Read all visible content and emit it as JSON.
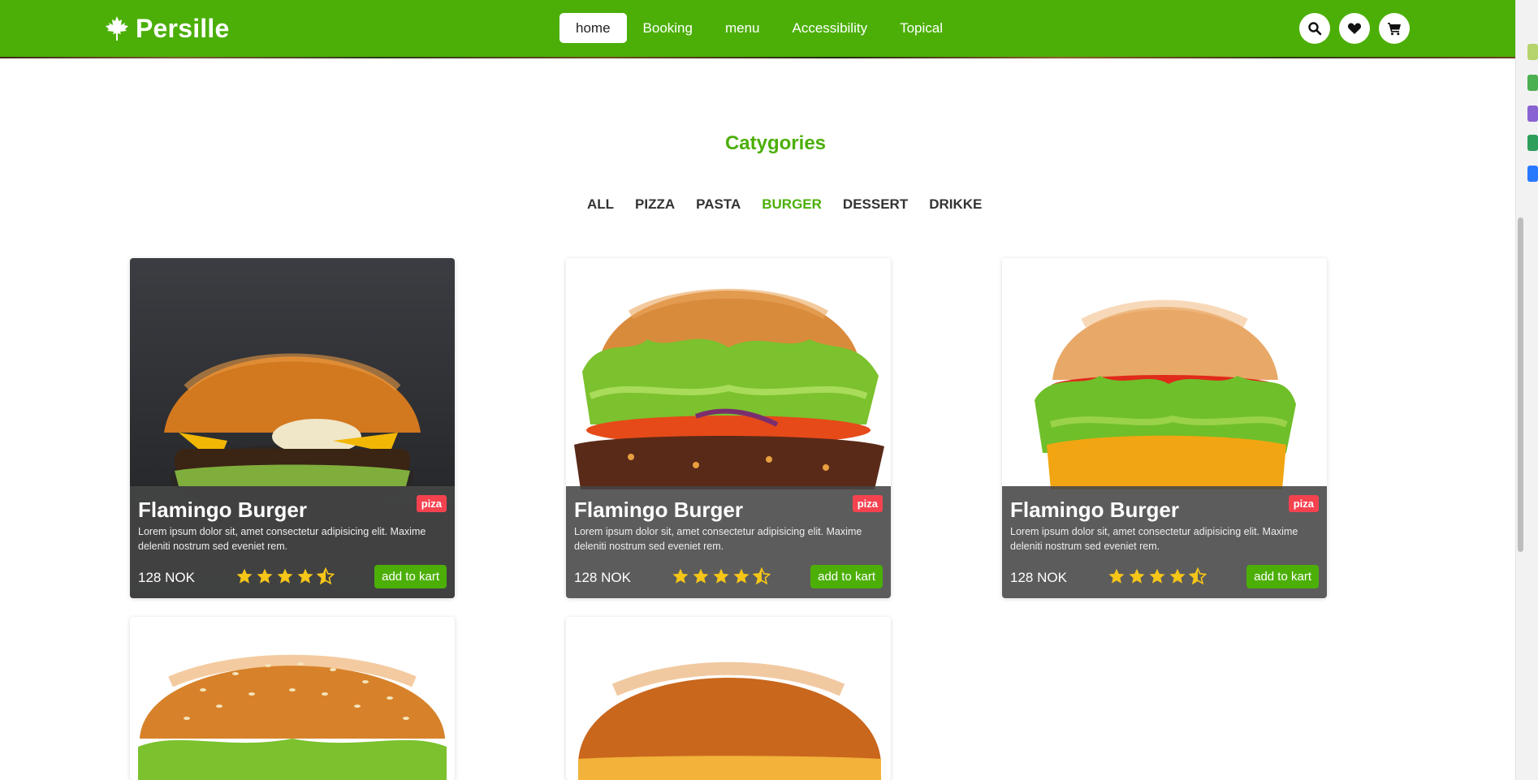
{
  "brand": {
    "name": "Persille",
    "icon": "maple-leaf-icon"
  },
  "nav": {
    "links": [
      {
        "label": "home",
        "active": true
      },
      {
        "label": "Booking",
        "active": false
      },
      {
        "label": "menu",
        "active": false
      },
      {
        "label": "Accessibility",
        "active": false
      },
      {
        "label": "Topical",
        "active": false
      }
    ],
    "icons": [
      "search-icon",
      "heart-icon",
      "cart-icon"
    ]
  },
  "categories": {
    "title": "Catygories",
    "filters": [
      {
        "label": "ALL",
        "active": false
      },
      {
        "label": "PIZZA",
        "active": false
      },
      {
        "label": "PASTA",
        "active": false
      },
      {
        "label": "BURGER",
        "active": true
      },
      {
        "label": "DESSERT",
        "active": false
      },
      {
        "label": "DRIKKE",
        "active": false
      }
    ]
  },
  "cards": [
    {
      "name": "Flamingo Burger",
      "badge": "piza",
      "description": "Lorem ipsum dolor sit, amet consectetur adipisicing elit. Maxime deleniti nostrum sed eveniet rem.",
      "price": "128 NOK",
      "rating": 4.5,
      "button": "add to kart"
    },
    {
      "name": "Flamingo Burger",
      "badge": "piza",
      "description": "Lorem ipsum dolor sit, amet consectetur adipisicing elit. Maxime deleniti nostrum sed eveniet rem.",
      "price": "128 NOK",
      "rating": 4.5,
      "button": "add to kart"
    },
    {
      "name": "Flamingo Burger",
      "badge": "piza",
      "description": "Lorem ipsum dolor sit, amet consectetur adipisicing elit. Maxime deleniti nostrum sed eveniet rem.",
      "price": "128 NOK",
      "rating": 4.5,
      "button": "add to kart"
    }
  ],
  "colors": {
    "brand_green": "#4caf08",
    "badge_red": "#f4424f",
    "star_yellow": "#f5c518",
    "overlay": "#464646"
  }
}
